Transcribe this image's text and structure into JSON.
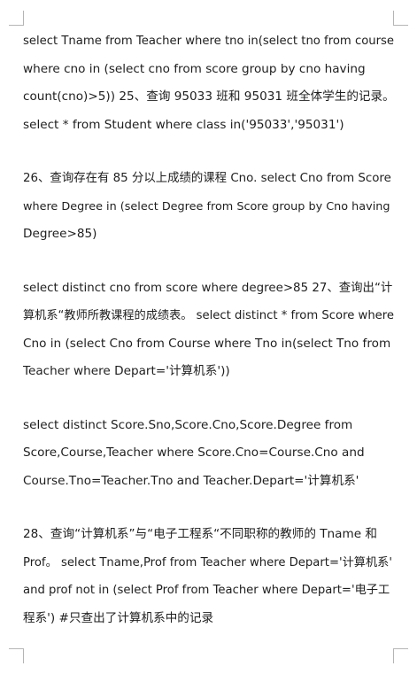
{
  "paragraphs": [
    {
      "lines": [
        "select Tname from Teacher where tno in(select tno from course",
        "where cno in (select cno from score group by cno having",
        "count(cno)>5)) 25、查询 95033 班和 95031 班全体学生的记录。",
        "select * from Student where class in('95033','95031')"
      ]
    },
    {
      "lines": [
        "26、查询存在有 85 分以上成绩的课程 Cno. select Cno from Score",
        "where Degree in (select Degree from Score group by Cno having",
        "Degree>85)"
      ]
    },
    {
      "lines": [
        "select distinct cno from score where degree>85 27、查询出“计",
        "算机系“教师所教课程的成绩表。 select distinct * from Score where",
        "Cno in (select Cno from Course where Tno in(select Tno from",
        "Teacher where Depart='计算机系'))"
      ]
    },
    {
      "lines": [
        "select distinct Score.Sno,Score.Cno,Score.Degree from",
        "Score,Course,Teacher where Score.Cno=Course.Cno and",
        "Course.Tno=Teacher.Tno and Teacher.Depart='计算机系'"
      ]
    },
    {
      "lines": [
        "28、查询“计算机系”与“电子工程系“不同职称的教师的 Tname 和",
        "Prof。 select Tname,Prof from Teacher where Depart='计算机系'",
        "and prof not in (select Prof from Teacher where Depart='电子工",
        "程系') #只查出了计算机系中的记录"
      ]
    }
  ]
}
